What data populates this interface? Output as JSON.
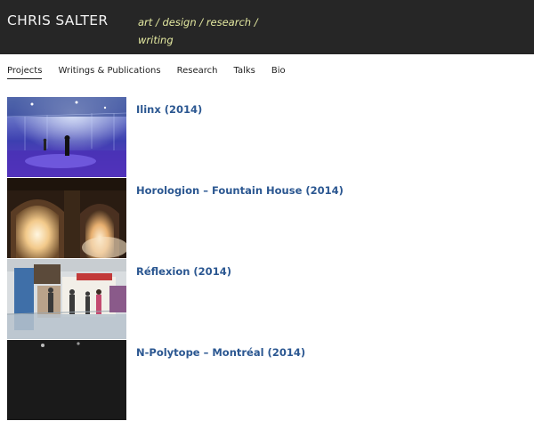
{
  "header": {
    "site_title": "CHRIS SALTER",
    "tagline": "art / design / research / writing"
  },
  "nav": {
    "items": [
      {
        "label": "Projects",
        "active": true
      },
      {
        "label": "Writings & Publications",
        "active": false
      },
      {
        "label": "Research",
        "active": false
      },
      {
        "label": "Talks",
        "active": false
      },
      {
        "label": "Bio",
        "active": false
      }
    ]
  },
  "projects": [
    {
      "title": "Ilinx (2014)"
    },
    {
      "title": "Horologion – Fountain House (2014)"
    },
    {
      "title": "Réflexion (2014)"
    },
    {
      "title": "N-Polytope – Montréal (2014)"
    }
  ],
  "colors": {
    "header_bg": "#262626",
    "tagline": "#e3e8a0",
    "link": "#2b5791"
  }
}
